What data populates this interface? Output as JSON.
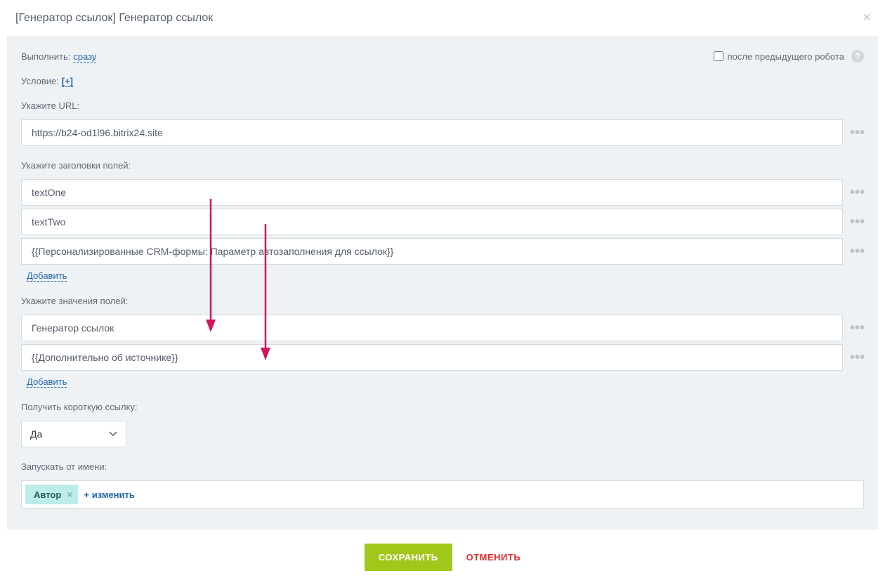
{
  "header": {
    "title": "[Генератор ссылок] Генератор ссылок"
  },
  "execute": {
    "label": "Выполнить:",
    "value": "сразу",
    "after_prev_label": "после предыдущего робота"
  },
  "condition": {
    "label": "Условие:",
    "add": "[+]"
  },
  "url": {
    "label": "Укажите URL:",
    "value": "https://b24-od1l96.bitrix24.site"
  },
  "headers": {
    "label": "Укажите заголовки полей:",
    "values": [
      "textOne",
      "textTwo",
      "{{Персонализированные CRM-формы: Параметр автозаполнения для ссылок}}"
    ],
    "add": "Добавить"
  },
  "values": {
    "label": "Укажите значения полей:",
    "values": [
      "Генератор ссылок",
      "{{Дополнительно об источнике}}"
    ],
    "add": "Добавить"
  },
  "shortlink": {
    "label": "Получить короткую ссылку:",
    "value": "Да"
  },
  "runas": {
    "label": "Запускать от имени:",
    "tag": "Автор",
    "change": "изменить"
  },
  "footer": {
    "save": "СОХРАНИТЬ",
    "cancel": "ОТМЕНИТЬ"
  },
  "icons": {
    "dots": "•••",
    "help": "?",
    "close": "×",
    "plus": "+"
  }
}
